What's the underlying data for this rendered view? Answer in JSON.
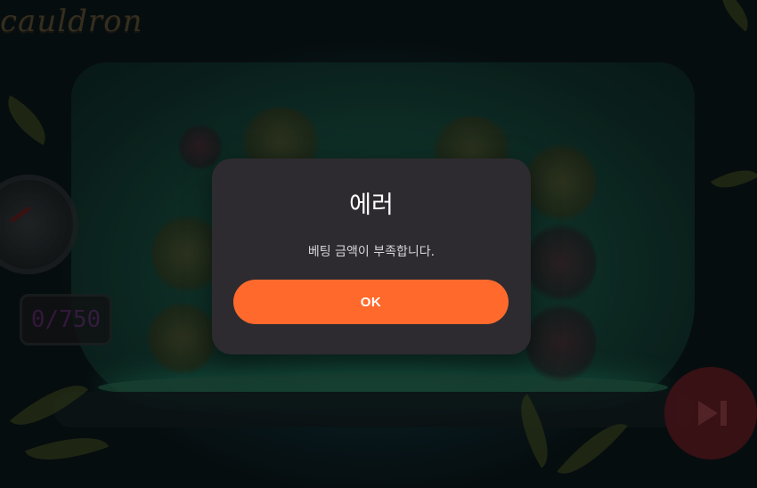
{
  "game": {
    "logo_text": "cauldron",
    "counter_text": "0/750",
    "skip_button_icon": "skip-forward-icon"
  },
  "dialog": {
    "title": "에러",
    "message": "베팅 금액이 부족합니다.",
    "ok_label": "OK"
  },
  "colors": {
    "dialog_background": "#2d2b30",
    "ok_button": "#ff6a2c",
    "skip_button": "#5e1c22"
  }
}
